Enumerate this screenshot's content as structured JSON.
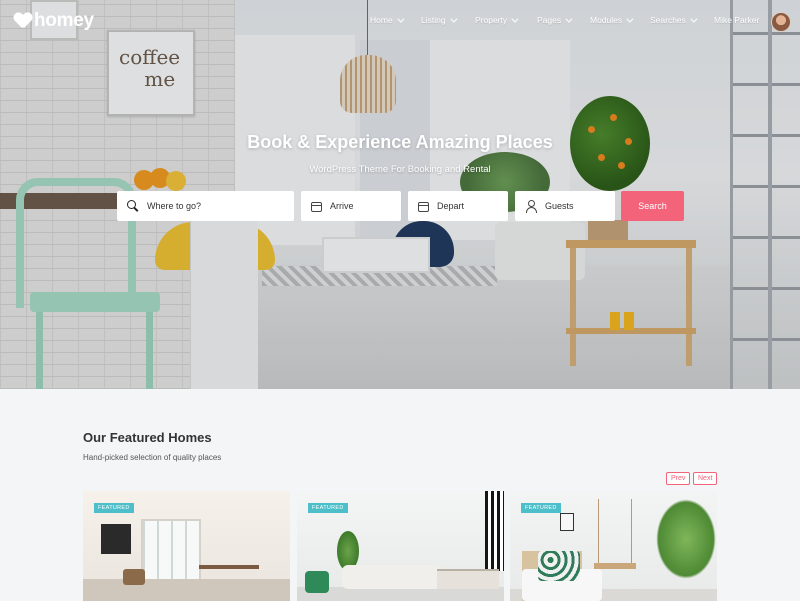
{
  "brand": {
    "name": "homey"
  },
  "nav": {
    "items": [
      {
        "label": "Home",
        "has_dropdown": true
      },
      {
        "label": "Listing",
        "has_dropdown": true
      },
      {
        "label": "Property",
        "has_dropdown": true
      },
      {
        "label": "Pages",
        "has_dropdown": true
      },
      {
        "label": "Modules",
        "has_dropdown": true
      },
      {
        "label": "Searches",
        "has_dropdown": true
      }
    ],
    "user_name": "Mike Parker"
  },
  "hero": {
    "title": "Book & Experience Amazing Places",
    "subtitle": "WordPress Theme For Booking and Rental"
  },
  "search": {
    "where_placeholder": "Where to go?",
    "arrive_placeholder": "Arrive",
    "depart_placeholder": "Depart",
    "guests_placeholder": "Guests",
    "button_label": "Search"
  },
  "featured": {
    "title": "Our Featured Homes",
    "subtitle": "Hand-picked selection of quality places",
    "prev_label": "Prev",
    "next_label": "Next",
    "cards": [
      {
        "badge": "FEATURED"
      },
      {
        "badge": "FEATURED"
      },
      {
        "badge": "FEATURED"
      }
    ]
  },
  "colors": {
    "accent": "#f3637a",
    "badge": "#4cbfca",
    "background": "#f3f5f7"
  },
  "icons": [
    "search-icon",
    "calendar-icon",
    "user-icon",
    "chevron-down-icon"
  ]
}
